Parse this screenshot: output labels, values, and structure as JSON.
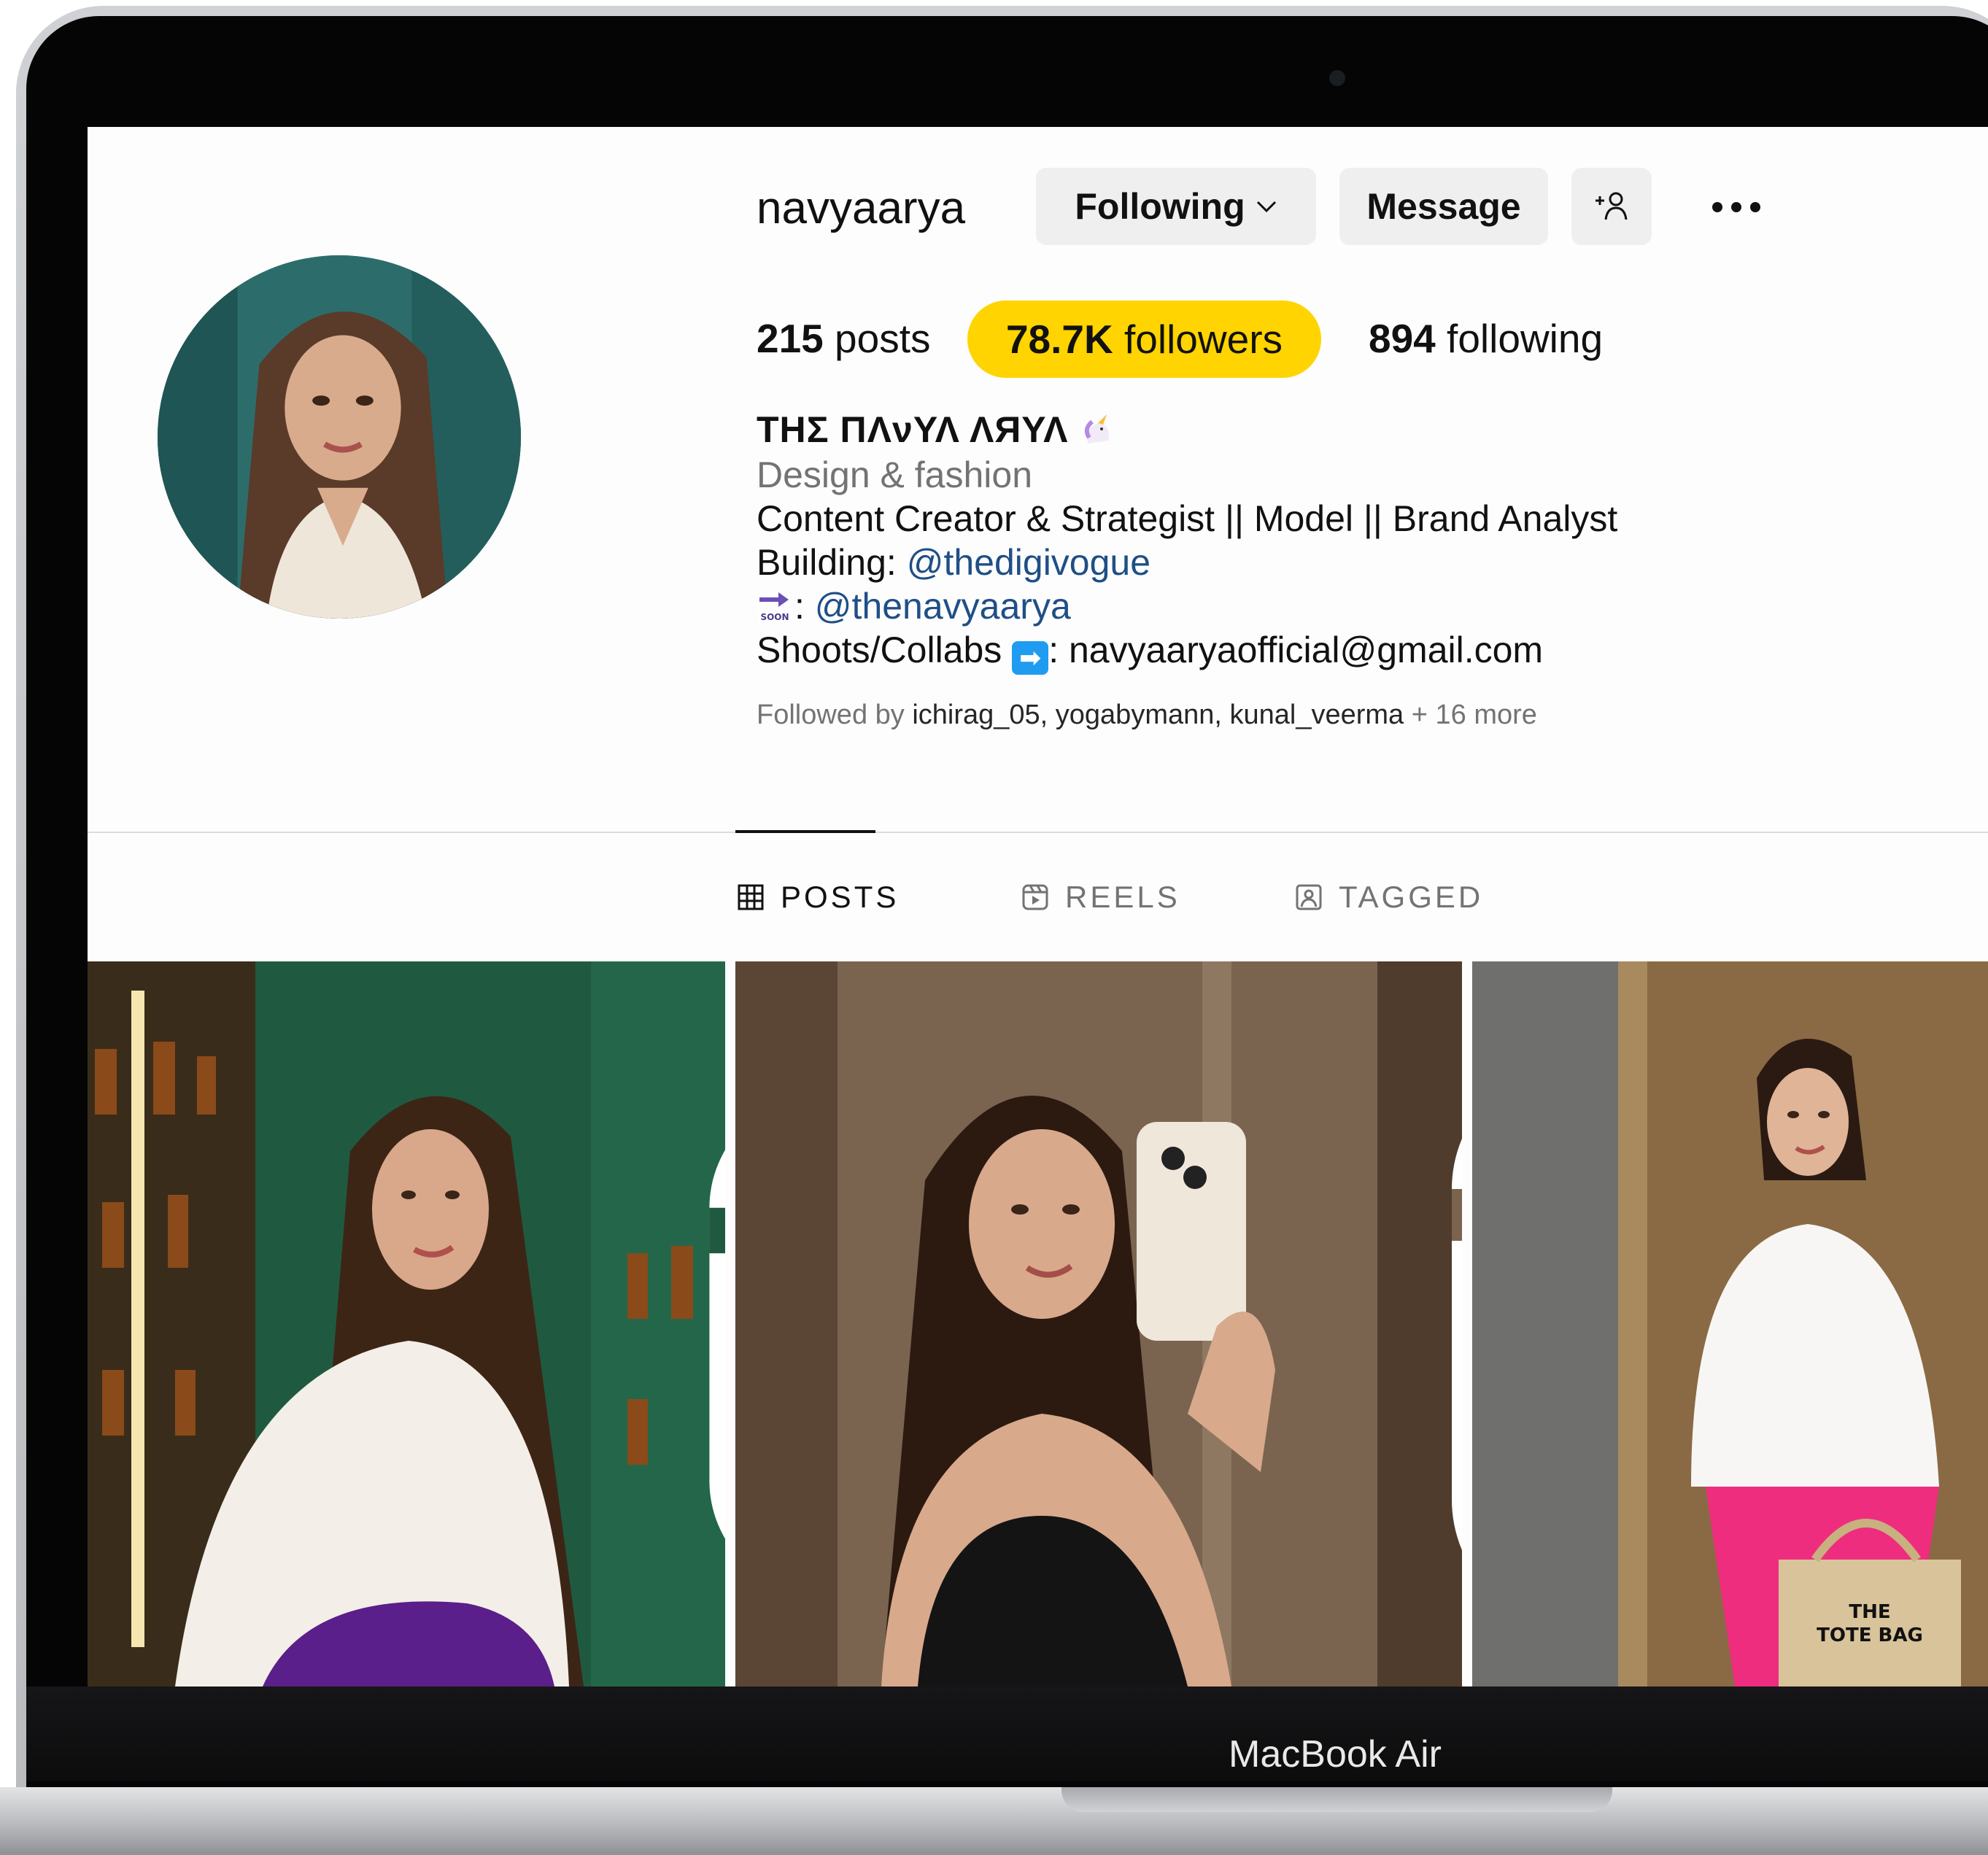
{
  "profile": {
    "username": "navyaarya",
    "following_button": "Following",
    "message_button": "Message",
    "suggest_icon": "+☺",
    "stats": {
      "posts_count": "215",
      "posts_label": " posts",
      "followers_count": "78.7K",
      "followers_label": " followers",
      "following_count": "894",
      "following_label": " following"
    },
    "display_name": "ТΗΣ ΠΛνΥΛ ΛЯΥΛ",
    "category": "Design & fashion",
    "bio_line1": "Content Creator & Strategist || Model || Brand Analyst",
    "bio_line2_prefix": "Building: ",
    "bio_line2_link": "@thedigivogue",
    "bio_line3_prefix": ": ",
    "bio_line3_link": "@thenavyaarya",
    "bio_line4_prefix": "Shoots/Collabs ",
    "bio_line4_suffix": ": navyaaryaofficial@gmail.com",
    "followed_by_prefix": "Followed by ",
    "followed_by_names": "ichirag_05, yogabymann, kunal_veerma",
    "followed_by_suffix": " + 16 more"
  },
  "tabs": [
    {
      "label": "POSTS",
      "icon": "grid-icon",
      "active": true
    },
    {
      "label": "REELS",
      "icon": "reels-icon",
      "active": false
    },
    {
      "label": "TAGGED",
      "icon": "tagged-icon",
      "active": false
    }
  ],
  "device_label": "MacBook Air",
  "colors": {
    "highlight": "#ffd400",
    "link": "#1f4f86",
    "button_bg": "#efefef"
  }
}
